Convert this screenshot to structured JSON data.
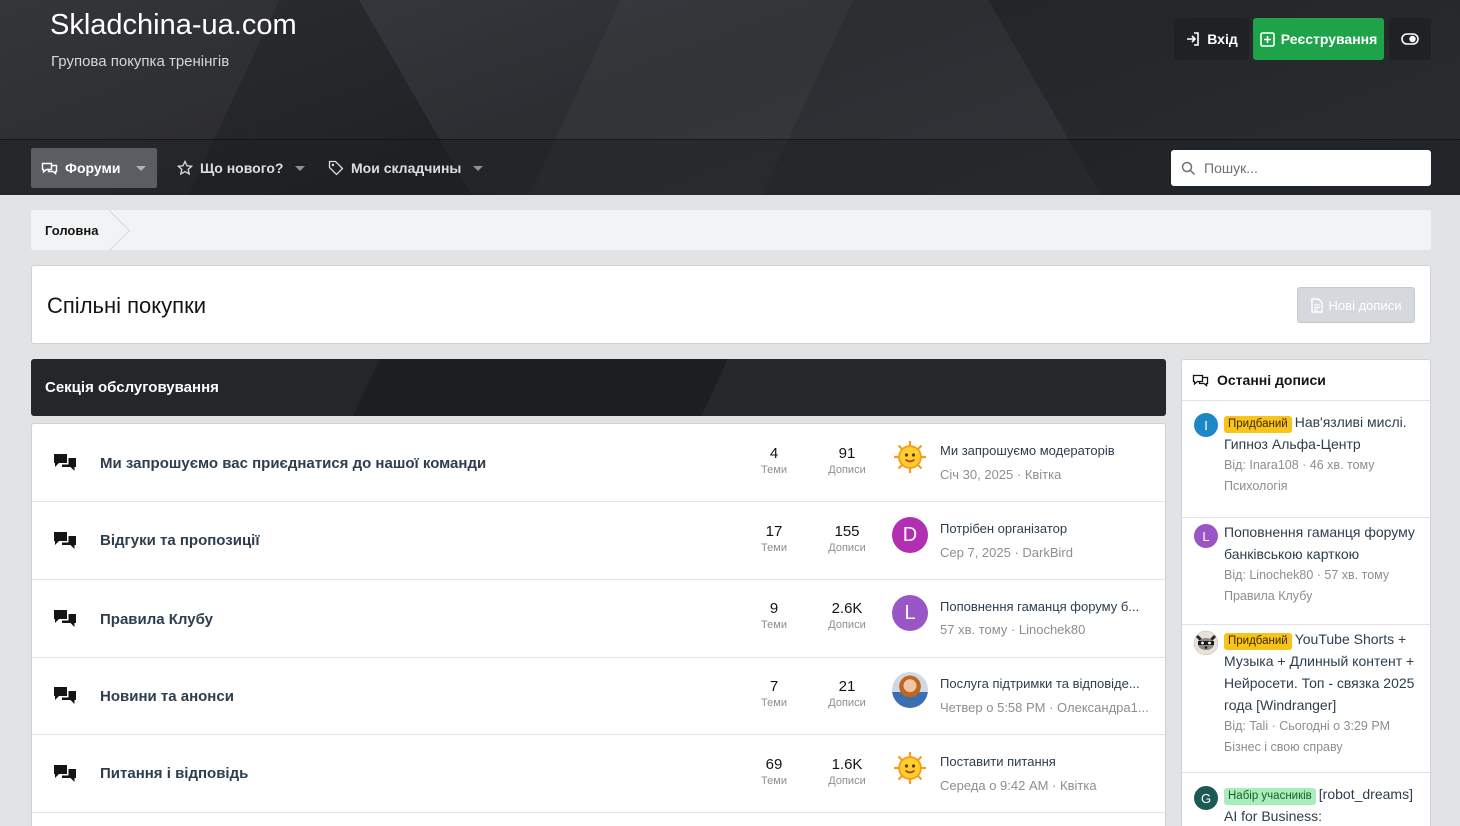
{
  "header": {
    "site_title": "Skladchina-ua.com",
    "site_subtitle": "Групова покупка тренінгів",
    "login_label": "Вхід",
    "register_label": "Реєстрування"
  },
  "nav": {
    "forums": "Форуми",
    "whats_new": "Що нового?",
    "my_skladchyny": "Мои складчины",
    "search_placeholder": "Пошук..."
  },
  "breadcrumb": {
    "home": "Головна"
  },
  "page": {
    "title": "Спільні покупки",
    "new_posts_label": "Нові дописи"
  },
  "section": {
    "title": "Секція обслуговування"
  },
  "forums": [
    {
      "name": "Ми запрошуємо вас приєднатися до нашої команди",
      "topics": "4",
      "topics_label": "Теми",
      "posts": "91",
      "posts_label": "Дописи",
      "last_title": "Ми запрошуємо модераторів",
      "last_meta": "Січ 30, 2025 · Квітка",
      "avatar": "sun"
    },
    {
      "name": "Відгуки та пропозиції",
      "topics": "17",
      "topics_label": "Теми",
      "posts": "155",
      "posts_label": "Дописи",
      "last_title": "Потрібен організатор",
      "last_meta": "Сер 7, 2025 · DarkBird",
      "avatar": "D"
    },
    {
      "name": "Правила Клубу",
      "topics": "9",
      "topics_label": "Теми",
      "posts": "2.6K",
      "posts_label": "Дописи",
      "last_title": "Поповнення гаманця форуму б...",
      "last_meta": "57 хв. тому · Linochek80",
      "avatar": "L"
    },
    {
      "name": "Новини та анонси",
      "topics": "7",
      "topics_label": "Теми",
      "posts": "21",
      "posts_label": "Дописи",
      "last_title": "Послуга підтримки та відповіде...",
      "last_meta": "Четвер о 5:58 PM · Олександра1...",
      "avatar": "photo"
    },
    {
      "name": "Питання і відповідь",
      "topics": "69",
      "topics_label": "Теми",
      "posts": "1.6K",
      "posts_label": "Дописи",
      "last_title": "Поставити питання",
      "last_meta": "Середа о 9:42 AM · Квітка",
      "avatar": "sun"
    }
  ],
  "sidebar": {
    "title": "Останні дописи",
    "items": [
      {
        "badge": "Придбаний",
        "title": "Нав'язливі мислі. Гипноз Альфа-Центр",
        "meta": "Від: Inara108 · 46 хв. тому",
        "forum": "Психологія",
        "avatar": "I"
      },
      {
        "badge": "",
        "title": "Поповнення гаманця форуму банківською карткою",
        "meta": "Від: Linochek80 · 57 хв. тому",
        "forum": "Правила Клубу",
        "avatar": "L"
      },
      {
        "badge": "Придбаний",
        "title": "YouTube Shorts + Музыка + Длинный контент + Нейросети. Топ - связка 2025 года [Windranger]",
        "meta": "Від: Tali · Сьогодні о 3:29 PM",
        "forum": "Бізнес і свою справу",
        "avatar": ""
      },
      {
        "badge": "Набір учасників",
        "title": "[robot_dreams] AI for Business: Впроваджуємо",
        "meta": "",
        "forum": "",
        "avatar": "G"
      }
    ]
  },
  "colors": {
    "register_green": "#1ea24a",
    "badge_bought": "#f8c31a",
    "badge_recruit": "#a8eebc",
    "link_text": "#2d3e4e"
  }
}
